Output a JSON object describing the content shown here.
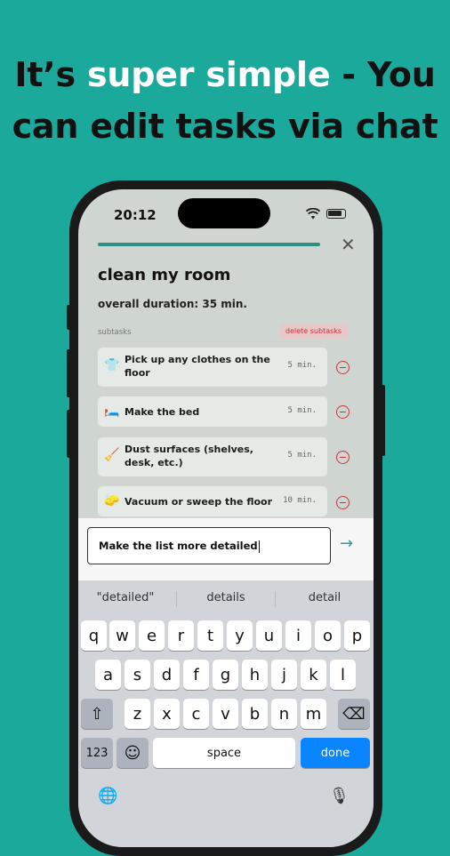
{
  "headline": {
    "line1_prefix": "It’s ",
    "line1_highlight": "super simple",
    "line1_suffix": " - You",
    "line2": "can edit tasks via chat"
  },
  "status_bar": {
    "time": "20:12"
  },
  "task": {
    "title": "clean my room",
    "duration": "overall duration: 35 min.",
    "subtasks_label": "subtasks",
    "delete_label": "delete subtasks",
    "close_icon": "close-icon",
    "subtasks": [
      {
        "emoji": "👕",
        "text": "Pick up any clothes on the floor",
        "duration": "5 min."
      },
      {
        "emoji": "🛏️",
        "text": "Make the bed",
        "duration": "5 min."
      },
      {
        "emoji": "🧹",
        "text": "Dust surfaces (shelves, desk, etc.)",
        "duration": "5 min."
      },
      {
        "emoji": "🧽",
        "text": "Vacuum or sweep the floor",
        "duration": "10 min."
      }
    ]
  },
  "chat": {
    "input_value": "Make the list more detailed",
    "send_icon": "arrow-right-icon"
  },
  "keyboard": {
    "suggestions": [
      "\"detailed\"",
      "details",
      "detail"
    ],
    "row1": [
      "q",
      "w",
      "e",
      "r",
      "t",
      "y",
      "u",
      "i",
      "o",
      "p"
    ],
    "row2": [
      "a",
      "s",
      "d",
      "f",
      "g",
      "h",
      "j",
      "k",
      "l"
    ],
    "row3": [
      "z",
      "x",
      "c",
      "v",
      "b",
      "n",
      "m"
    ],
    "shift": "⇧",
    "backspace": "⌫",
    "numbers": "123",
    "emoji": "☺",
    "space": "space",
    "done": "done",
    "globe": "🌐",
    "mic": "🎙"
  },
  "colors": {
    "background": "#1aa99a",
    "accent": "#2f8f86",
    "done_key": "#0a84ff",
    "danger": "#c4363c"
  }
}
